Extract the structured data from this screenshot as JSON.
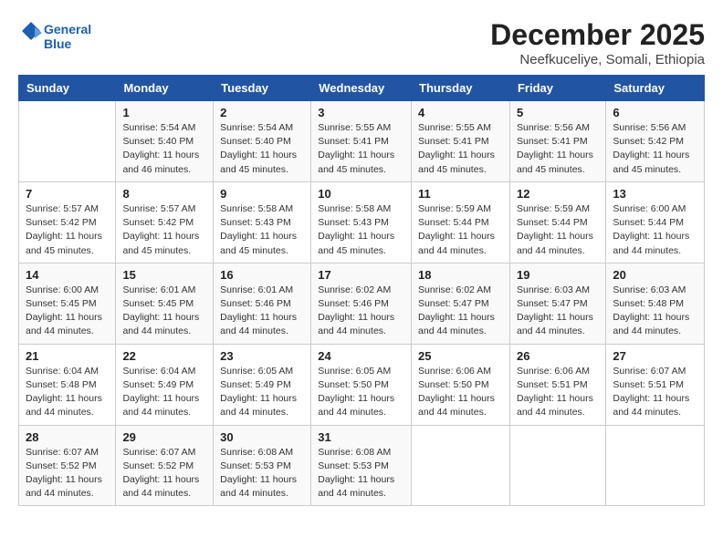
{
  "header": {
    "logo_general": "General",
    "logo_blue": "Blue",
    "title": "December 2025",
    "subtitle": "Neefkuceliye, Somali, Ethiopia"
  },
  "calendar": {
    "days_of_week": [
      "Sunday",
      "Monday",
      "Tuesday",
      "Wednesday",
      "Thursday",
      "Friday",
      "Saturday"
    ],
    "weeks": [
      [
        {
          "day": "",
          "info": ""
        },
        {
          "day": "1",
          "info": "Sunrise: 5:54 AM\nSunset: 5:40 PM\nDaylight: 11 hours\nand 46 minutes."
        },
        {
          "day": "2",
          "info": "Sunrise: 5:54 AM\nSunset: 5:40 PM\nDaylight: 11 hours\nand 45 minutes."
        },
        {
          "day": "3",
          "info": "Sunrise: 5:55 AM\nSunset: 5:41 PM\nDaylight: 11 hours\nand 45 minutes."
        },
        {
          "day": "4",
          "info": "Sunrise: 5:55 AM\nSunset: 5:41 PM\nDaylight: 11 hours\nand 45 minutes."
        },
        {
          "day": "5",
          "info": "Sunrise: 5:56 AM\nSunset: 5:41 PM\nDaylight: 11 hours\nand 45 minutes."
        },
        {
          "day": "6",
          "info": "Sunrise: 5:56 AM\nSunset: 5:42 PM\nDaylight: 11 hours\nand 45 minutes."
        }
      ],
      [
        {
          "day": "7",
          "info": "Sunrise: 5:57 AM\nSunset: 5:42 PM\nDaylight: 11 hours\nand 45 minutes."
        },
        {
          "day": "8",
          "info": "Sunrise: 5:57 AM\nSunset: 5:42 PM\nDaylight: 11 hours\nand 45 minutes."
        },
        {
          "day": "9",
          "info": "Sunrise: 5:58 AM\nSunset: 5:43 PM\nDaylight: 11 hours\nand 45 minutes."
        },
        {
          "day": "10",
          "info": "Sunrise: 5:58 AM\nSunset: 5:43 PM\nDaylight: 11 hours\nand 45 minutes."
        },
        {
          "day": "11",
          "info": "Sunrise: 5:59 AM\nSunset: 5:44 PM\nDaylight: 11 hours\nand 44 minutes."
        },
        {
          "day": "12",
          "info": "Sunrise: 5:59 AM\nSunset: 5:44 PM\nDaylight: 11 hours\nand 44 minutes."
        },
        {
          "day": "13",
          "info": "Sunrise: 6:00 AM\nSunset: 5:44 PM\nDaylight: 11 hours\nand 44 minutes."
        }
      ],
      [
        {
          "day": "14",
          "info": "Sunrise: 6:00 AM\nSunset: 5:45 PM\nDaylight: 11 hours\nand 44 minutes."
        },
        {
          "day": "15",
          "info": "Sunrise: 6:01 AM\nSunset: 5:45 PM\nDaylight: 11 hours\nand 44 minutes."
        },
        {
          "day": "16",
          "info": "Sunrise: 6:01 AM\nSunset: 5:46 PM\nDaylight: 11 hours\nand 44 minutes."
        },
        {
          "day": "17",
          "info": "Sunrise: 6:02 AM\nSunset: 5:46 PM\nDaylight: 11 hours\nand 44 minutes."
        },
        {
          "day": "18",
          "info": "Sunrise: 6:02 AM\nSunset: 5:47 PM\nDaylight: 11 hours\nand 44 minutes."
        },
        {
          "day": "19",
          "info": "Sunrise: 6:03 AM\nSunset: 5:47 PM\nDaylight: 11 hours\nand 44 minutes."
        },
        {
          "day": "20",
          "info": "Sunrise: 6:03 AM\nSunset: 5:48 PM\nDaylight: 11 hours\nand 44 minutes."
        }
      ],
      [
        {
          "day": "21",
          "info": "Sunrise: 6:04 AM\nSunset: 5:48 PM\nDaylight: 11 hours\nand 44 minutes."
        },
        {
          "day": "22",
          "info": "Sunrise: 6:04 AM\nSunset: 5:49 PM\nDaylight: 11 hours\nand 44 minutes."
        },
        {
          "day": "23",
          "info": "Sunrise: 6:05 AM\nSunset: 5:49 PM\nDaylight: 11 hours\nand 44 minutes."
        },
        {
          "day": "24",
          "info": "Sunrise: 6:05 AM\nSunset: 5:50 PM\nDaylight: 11 hours\nand 44 minutes."
        },
        {
          "day": "25",
          "info": "Sunrise: 6:06 AM\nSunset: 5:50 PM\nDaylight: 11 hours\nand 44 minutes."
        },
        {
          "day": "26",
          "info": "Sunrise: 6:06 AM\nSunset: 5:51 PM\nDaylight: 11 hours\nand 44 minutes."
        },
        {
          "day": "27",
          "info": "Sunrise: 6:07 AM\nSunset: 5:51 PM\nDaylight: 11 hours\nand 44 minutes."
        }
      ],
      [
        {
          "day": "28",
          "info": "Sunrise: 6:07 AM\nSunset: 5:52 PM\nDaylight: 11 hours\nand 44 minutes."
        },
        {
          "day": "29",
          "info": "Sunrise: 6:07 AM\nSunset: 5:52 PM\nDaylight: 11 hours\nand 44 minutes."
        },
        {
          "day": "30",
          "info": "Sunrise: 6:08 AM\nSunset: 5:53 PM\nDaylight: 11 hours\nand 44 minutes."
        },
        {
          "day": "31",
          "info": "Sunrise: 6:08 AM\nSunset: 5:53 PM\nDaylight: 11 hours\nand 44 minutes."
        },
        {
          "day": "",
          "info": ""
        },
        {
          "day": "",
          "info": ""
        },
        {
          "day": "",
          "info": ""
        }
      ]
    ]
  }
}
